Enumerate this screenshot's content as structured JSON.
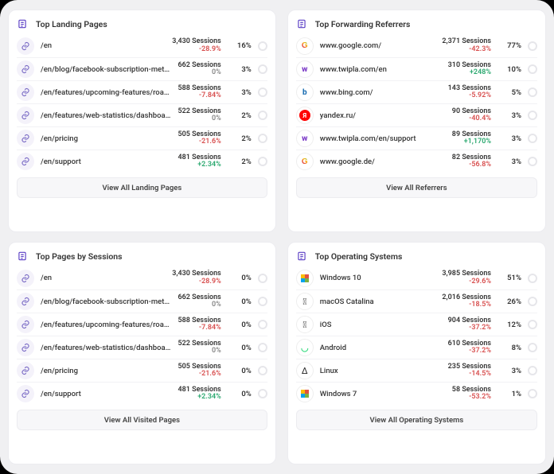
{
  "cards": [
    {
      "id": "landing-pages",
      "title": "Top Landing Pages",
      "header_icon": "clipboard-icon",
      "button": "View All Landing Pages",
      "row_icon_kind": "link-icon",
      "rows": [
        {
          "label": "/en",
          "sessions": "3,430 Sessions",
          "delta": "-28.9%",
          "delta_sign": "neg",
          "pct": "16%"
        },
        {
          "label": "/en/blog/facebook-subscription-meta-to…",
          "sessions": "662 Sessions",
          "delta": "0%",
          "delta_sign": "zero",
          "pct": "3%"
        },
        {
          "label": "/en/features/upcoming-features/roadmap",
          "sessions": "588 Sessions",
          "delta": "-7.84%",
          "delta_sign": "neg",
          "pct": "3%"
        },
        {
          "label": "/en/features/web-statistics/dashboards",
          "sessions": "522 Sessions",
          "delta": "0%",
          "delta_sign": "zero",
          "pct": "2%"
        },
        {
          "label": "/en/pricing",
          "sessions": "505 Sessions",
          "delta": "-21.6%",
          "delta_sign": "neg",
          "pct": "2%"
        },
        {
          "label": "/en/support",
          "sessions": "481 Sessions",
          "delta": "+2.34%",
          "delta_sign": "pos",
          "pct": "2%"
        }
      ]
    },
    {
      "id": "forwarding-referrers",
      "title": "Top Forwarding Referrers",
      "header_icon": "clipboard-icon",
      "button": "View All Referrers",
      "row_icon_kind": "favicon",
      "rows": [
        {
          "icon": "google",
          "label": "www.google.com/",
          "sessions": "2,371 Sessions",
          "delta": "-42.3%",
          "delta_sign": "neg",
          "pct": "77%"
        },
        {
          "icon": "twipla",
          "label": "www.twipla.com/en",
          "sessions": "310 Sessions",
          "delta": "+248%",
          "delta_sign": "pos",
          "pct": "10%"
        },
        {
          "icon": "bing",
          "label": "www.bing.com/",
          "sessions": "143 Sessions",
          "delta": "-5.92%",
          "delta_sign": "neg",
          "pct": "5%"
        },
        {
          "icon": "yandex",
          "label": "yandex.ru/",
          "sessions": "90 Sessions",
          "delta": "-40.4%",
          "delta_sign": "neg",
          "pct": "3%"
        },
        {
          "icon": "twipla",
          "label": "www.twipla.com/en/support",
          "sessions": "89 Sessions",
          "delta": "+1,170%",
          "delta_sign": "pos",
          "pct": "3%"
        },
        {
          "icon": "google",
          "label": "www.google.de/",
          "sessions": "82 Sessions",
          "delta": "-56.8%",
          "delta_sign": "neg",
          "pct": "3%"
        }
      ]
    },
    {
      "id": "pages-by-sessions",
      "title": "Top Pages by Sessions",
      "header_icon": "clipboard-icon",
      "button": "View All Visited Pages",
      "row_icon_kind": "link-icon",
      "rows": [
        {
          "label": "/en",
          "sessions": "3,430 Sessions",
          "delta": "-28.9%",
          "delta_sign": "neg",
          "pct": "0%"
        },
        {
          "label": "/en/blog/facebook-subscription-meta-to-…",
          "sessions": "662 Sessions",
          "delta": "0%",
          "delta_sign": "zero",
          "pct": "0%"
        },
        {
          "label": "/en/features/upcoming-features/roadmap",
          "sessions": "588 Sessions",
          "delta": "-7.84%",
          "delta_sign": "neg",
          "pct": "0%"
        },
        {
          "label": "/en/features/web-statistics/dashboards",
          "sessions": "522 Sessions",
          "delta": "0%",
          "delta_sign": "zero",
          "pct": "0%"
        },
        {
          "label": "/en/pricing",
          "sessions": "505 Sessions",
          "delta": "-21.6%",
          "delta_sign": "neg",
          "pct": "0%"
        },
        {
          "label": "/en/support",
          "sessions": "481 Sessions",
          "delta": "+2.34%",
          "delta_sign": "pos",
          "pct": "0%"
        }
      ]
    },
    {
      "id": "operating-systems",
      "title": "Top Operating Systems",
      "header_icon": "clipboard-icon",
      "button": "View All Operating Systems",
      "row_icon_kind": "os",
      "rows": [
        {
          "icon": "win",
          "label": "Windows 10",
          "sessions": "3,985 Sessions",
          "delta": "-29.6%",
          "delta_sign": "neg",
          "pct": "51%"
        },
        {
          "icon": "apple",
          "label": "macOS Catalina",
          "sessions": "2,016 Sessions",
          "delta": "-18.5%",
          "delta_sign": "neg",
          "pct": "26%"
        },
        {
          "icon": "apple",
          "label": "iOS",
          "sessions": "904 Sessions",
          "delta": "-37.2%",
          "delta_sign": "neg",
          "pct": "12%"
        },
        {
          "icon": "android",
          "label": "Android",
          "sessions": "610 Sessions",
          "delta": "-37.2%",
          "delta_sign": "neg",
          "pct": "8%"
        },
        {
          "icon": "linux",
          "label": "Linux",
          "sessions": "235 Sessions",
          "delta": "-14.5%",
          "delta_sign": "neg",
          "pct": "3%"
        },
        {
          "icon": "win",
          "label": "Windows 7",
          "sessions": "58 Sessions",
          "delta": "-53.2%",
          "delta_sign": "neg",
          "pct": "1%"
        }
      ]
    }
  ]
}
